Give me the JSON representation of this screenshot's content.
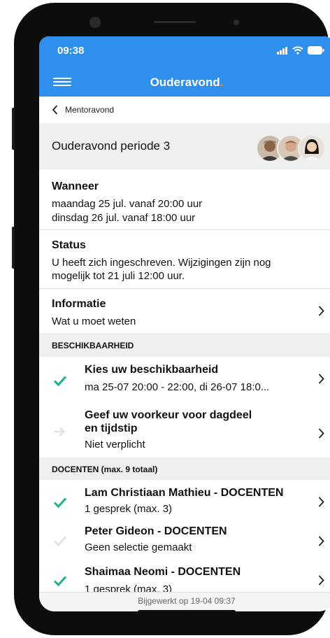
{
  "status_bar": {
    "time": "09:38"
  },
  "header": {
    "title": "Ouderavond",
    "title_dot": "."
  },
  "breadcrumb": {
    "label": "Mentoravond"
  },
  "event": {
    "title": "Ouderavond periode 3"
  },
  "wanneer": {
    "label": "Wanneer",
    "lines": [
      "maandag 25 jul. vanaf 20:00 uur",
      "dinsdag 26 jul. vanaf 18:00 uur"
    ]
  },
  "status": {
    "label": "Status",
    "lines": [
      "U heeft zich ingeschreven. Wijzigingen zijn nog",
      "mogelijk tot 21 juli 12:00 uur."
    ]
  },
  "informatie": {
    "label": "Informatie",
    "sub": "Wat u moet weten"
  },
  "beschikbaarheid": {
    "header": "BESCHIKBAARHEID",
    "items": [
      {
        "title": "Kies uw beschikbaarheid",
        "sub": "ma 25-07 20:00 - 22:00, di 26-07 18:0...",
        "done": true
      },
      {
        "title_lines": [
          "Geef uw voorkeur voor dagdeel",
          "en tijdstip"
        ],
        "sub": "Niet verplicht",
        "done": false
      }
    ]
  },
  "docenten": {
    "header": "DOCENTEN (max. 9 totaal)",
    "items": [
      {
        "title": "Lam Christiaan Mathieu - DOCENTEN",
        "sub": "1 gesprek (max. 3)",
        "done": true
      },
      {
        "title": "Peter Gideon  - DOCENTEN",
        "sub": "Geen selectie gemaakt",
        "done": false
      },
      {
        "title": "Shaimaa Neomi  - DOCENTEN",
        "sub": "1 gesprek (max. 3)",
        "done": true
      }
    ]
  },
  "footer": {
    "text": "Bijgewerkt op 19-04 09:37"
  },
  "colors": {
    "header_bg": "#2f8fec",
    "check_done": "#1fb08a",
    "check_off": "#e2e2e2",
    "accent_dot": "#ff8a00"
  }
}
